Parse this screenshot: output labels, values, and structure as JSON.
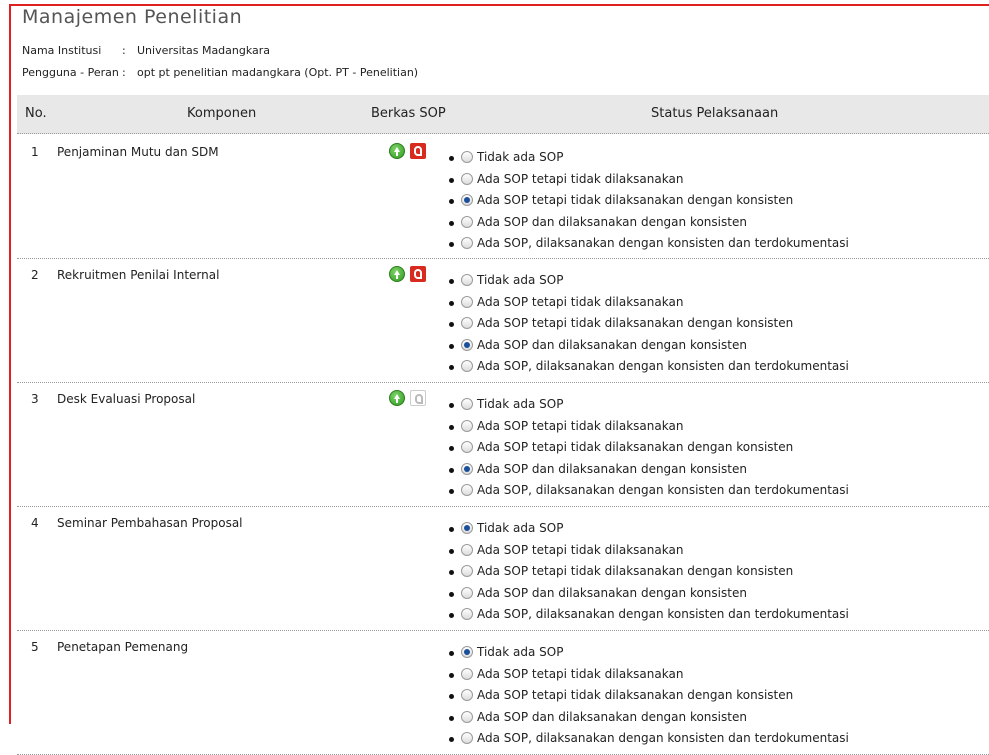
{
  "page": {
    "title": "Manajemen  Penelitian",
    "institution_label": "Nama Institusi",
    "institution_value": "Universitas Madangkara",
    "role_label": "Pengguna - Peran",
    "role_value": "opt pt penelitian madangkara (Opt. PT - Penelitian)",
    "colon": ":"
  },
  "table": {
    "headers": {
      "no": "No.",
      "komponen": "Komponen",
      "berkas": "Berkas SOP",
      "status": "Status Pelaksanaan"
    },
    "rows": [
      {
        "no": "1",
        "komponen": "Penjaminan Mutu dan SDM",
        "has_upload": true,
        "pdf_available": true,
        "selected": 2
      },
      {
        "no": "2",
        "komponen": "Rekruitmen Penilai Internal",
        "has_upload": true,
        "pdf_available": true,
        "selected": 3
      },
      {
        "no": "3",
        "komponen": "Desk Evaluasi Proposal",
        "has_upload": true,
        "pdf_available": false,
        "selected": 3
      },
      {
        "no": "4",
        "komponen": "Seminar Pembahasan Proposal",
        "has_upload": false,
        "pdf_available": false,
        "selected": 0
      },
      {
        "no": "5",
        "komponen": "Penetapan Pemenang",
        "has_upload": false,
        "pdf_available": false,
        "selected": 0
      }
    ]
  },
  "options": [
    "Tidak ada SOP",
    "Ada SOP tetapi tidak dilaksanakan",
    "Ada SOP tetapi tidak dilaksanakan dengan konsisten",
    "Ada SOP dan dilaksanakan dengan konsisten",
    "Ada SOP, dilaksanakan dengan konsisten dan terdokumentasi"
  ],
  "icons": {
    "upload": "upload-icon",
    "pdf": "pdf-icon",
    "pdf_disabled": "pdf-disabled-icon"
  },
  "colors": {
    "frame": "#e02020",
    "header_bg": "#e8e8e8",
    "upload": "#2f9a1e",
    "pdf": "#d82a1f",
    "radio_selected": "#1b4f9a"
  }
}
